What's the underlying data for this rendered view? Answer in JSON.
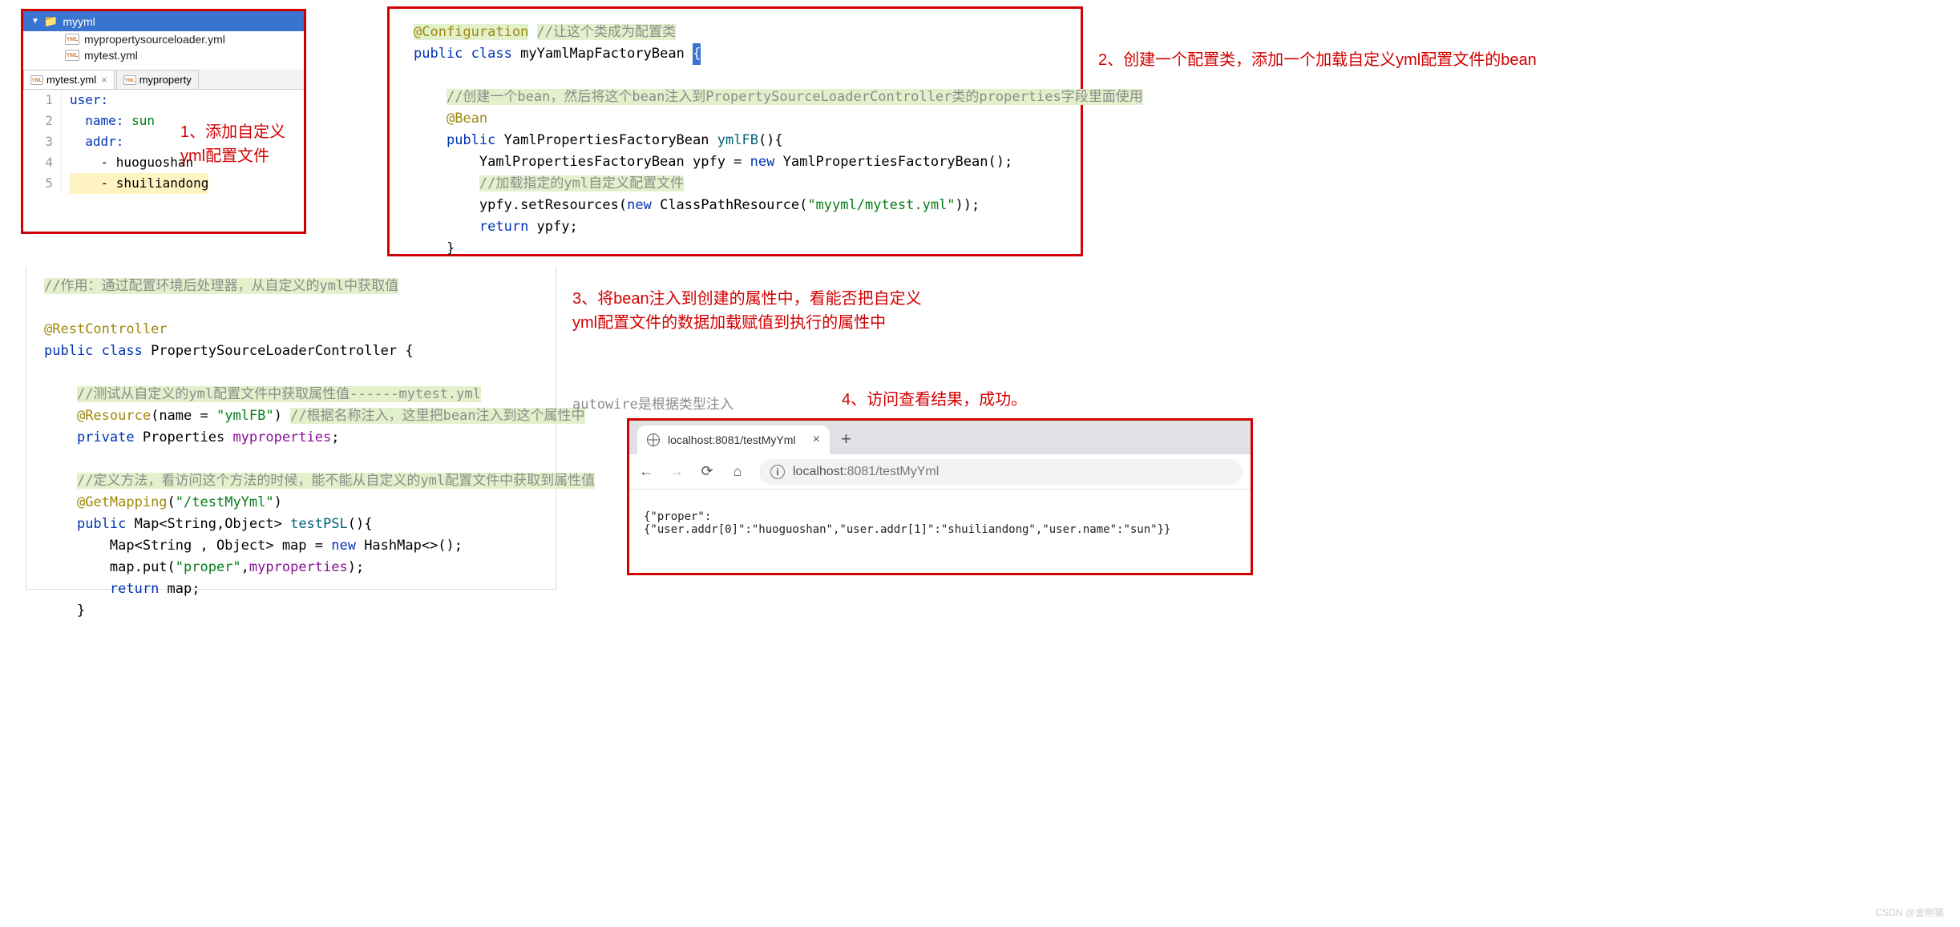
{
  "box1": {
    "folder": "myyml",
    "files": [
      "mypropertysourceloader.yml",
      "mytest.yml"
    ],
    "tabs": {
      "active": "mytest.yml",
      "inactive": "myproperty"
    },
    "yml": {
      "l1": "user:",
      "l2_k": "name:",
      "l2_v": " sun",
      "l3_k": "addr:",
      "l4": "- huoguoshan",
      "l5": "- shuiliandong"
    },
    "anno_a": "1、添加自定义",
    "anno_b": "yml配置文件"
  },
  "box2": {
    "l1_a": "@Configuration",
    "l1_c": "//让这个类成为配置类",
    "l2_a": "public",
    "l2_b": "class",
    "l2_c": "myYamlMapFactoryBean",
    "l2_brace": "{",
    "l4_c": "//创建一个bean，然后将这个bean注入到PropertySourceLoaderController类的properties字段里面使用",
    "l5": "@Bean",
    "l6_a": "public",
    "l6_b": "YamlPropertiesFactoryBean",
    "l6_c": "ymlFB",
    "l6_d": "(){",
    "l7_a": "YamlPropertiesFactoryBean ypfy = ",
    "l7_b": "new",
    "l7_c": " YamlPropertiesFactoryBean();",
    "l8_c": "//加载指定的yml自定义配置文件",
    "l9_a": "ypfy.setResources(",
    "l9_b": "new",
    "l9_c": " ClassPathResource(",
    "l9_s": "\"myyml/mytest.yml\"",
    "l9_d": "));",
    "l10_a": "return",
    "l10_b": " ypfy;",
    "l11": "}",
    "anno": "2、创建一个配置类，添加一个加载自定义yml配置文件的bean"
  },
  "box3": {
    "l1": "//作用：通过配置环境后处理器，从自定义的yml中获取值",
    "l3": "@RestController",
    "l4_a": "public",
    "l4_b": "class",
    "l4_c": "PropertySourceLoaderController {",
    "l6_c": "//测试从自定义的yml配置文件中获取属性值------mytest.yml",
    "l7_a": "@Resource",
    "l7_b": "(name = ",
    "l7_s": "\"ymlFB\"",
    "l7_c": ") ",
    "l7_cm": "//根据名称注入，这里把bean注入到这个属性中",
    "l8_a": "private",
    "l8_b": " Properties ",
    "l8_c": "myproperties",
    "l8_d": ";",
    "l10_c": "//定义方法，看访问这个方法的时候，能不能从自定义的yml配置文件中获取到属性值",
    "l11_a": "@GetMapping",
    "l11_b": "(",
    "l11_s": "\"/testMyYml\"",
    "l11_c": ")",
    "l12_a": "public",
    "l12_b": " Map<String,Object> ",
    "l12_c": "testPSL",
    "l12_d": "(){",
    "l13_a": "Map<String , Object> map = ",
    "l13_b": "new",
    "l13_c": " HashMap<>();",
    "l14_a": "map.put(",
    "l14_s": "\"proper\"",
    "l14_b": ",",
    "l14_c": "myproperties",
    "l14_d": ");",
    "l15_a": "return",
    "l15_b": " map;",
    "l16": "}",
    "autowire": "autowire是根据类型注入",
    "anno3a": "3、将bean注入到创建的属性中，看能否把自定义",
    "anno3b": "yml配置文件的数据加载赋值到执行的属性中",
    "anno4": "4、访问查看结果，成功。"
  },
  "browser": {
    "tab_title": "localhost:8081/testMyYml",
    "url_host": "localhost:",
    "url_port_path": "8081/testMyYml",
    "body": "{\"proper\":{\"user.addr[0]\":\"huoguoshan\",\"user.addr[1]\":\"shuiliandong\",\"user.name\":\"sun\"}}"
  },
  "watermark": "CSDN @金刚猿"
}
